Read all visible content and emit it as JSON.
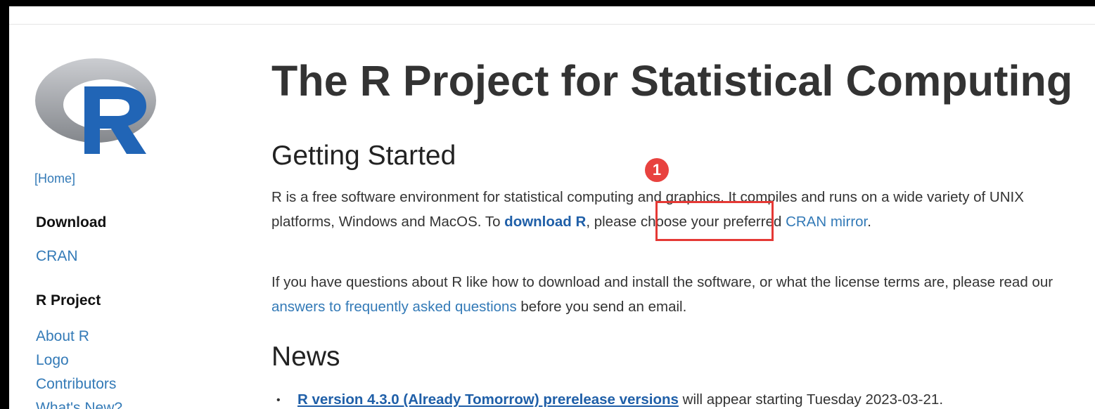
{
  "sidebar": {
    "home_label": "[Home]",
    "download_heading": "Download",
    "cran_link": "CRAN",
    "project_heading": "R Project",
    "about_link": "About R",
    "logo_link": "Logo",
    "contributors_link": "Contributors",
    "whats_new_link": "What's New?"
  },
  "main": {
    "title": "The R Project for Statistical Computing",
    "getting_started_heading": "Getting Started",
    "p1_text1": "R is a free software environment for statistical computing and graphics. It compiles and runs on a wide variety of UNIX platforms, Windows and MacOS. To ",
    "p1_download_link": "download R",
    "p1_text2": ", please choose your preferred ",
    "p1_cran_link": "CRAN mirror",
    "p1_text3": ".",
    "p2_text1": "If you have questions about R like how to download and install the software, or what the license terms are, please read our ",
    "p2_faq_link": "answers to frequently asked questions",
    "p2_text2": " before you send an email.",
    "news_heading": "News",
    "news_bullet": "•",
    "news_item_link": "R version 4.3.0 (Already Tomorrow) prerelease versions",
    "news_item_text": " will appear starting Tuesday 2023-03-21."
  },
  "annotation": {
    "badge_number": "1",
    "badge_color": "#e8423f",
    "box_color": "#e53935"
  },
  "colors": {
    "link": "#337ab7",
    "logo_blue": "#2165b6",
    "logo_gray": "#a7a9ad"
  }
}
